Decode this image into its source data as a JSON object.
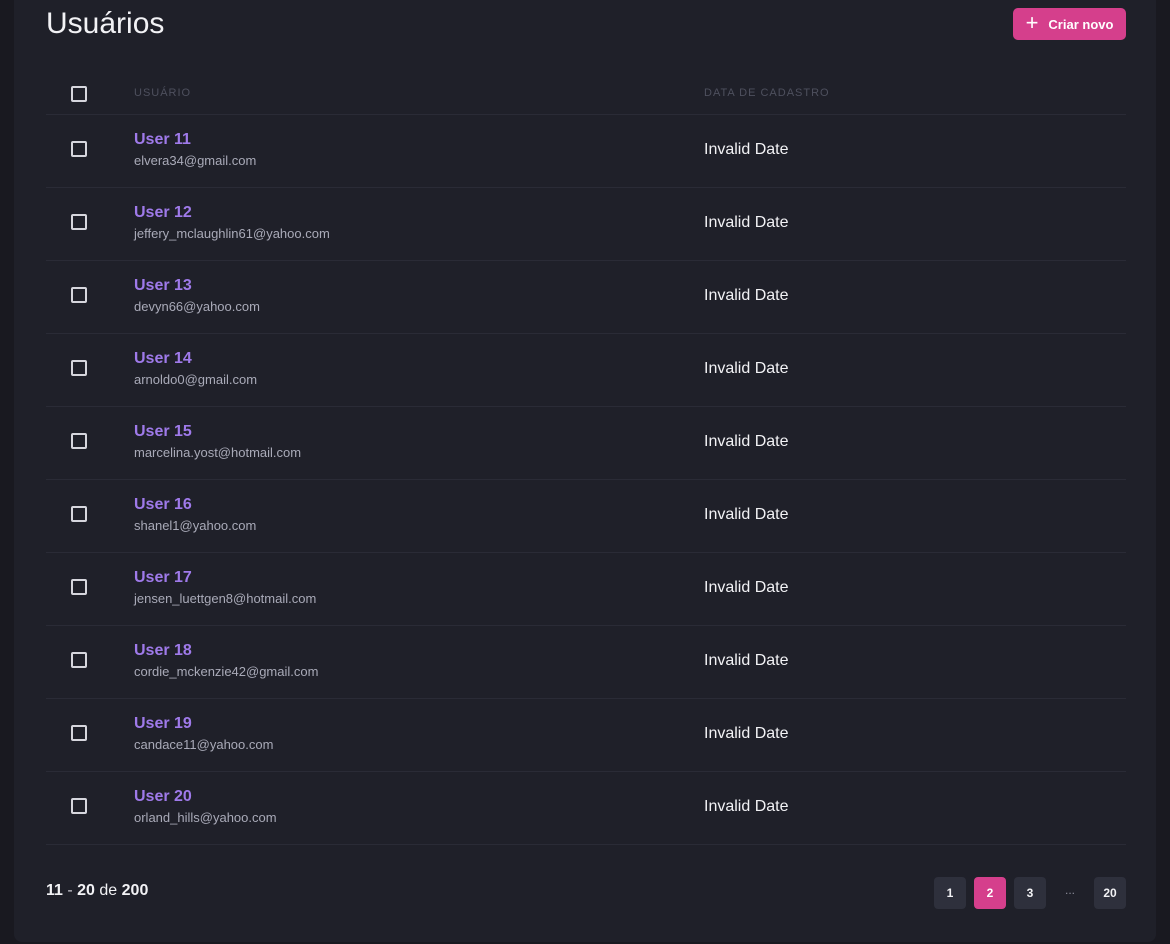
{
  "header": {
    "title": "Usuários",
    "create_label": "Criar novo",
    "create_icon": "plus-icon"
  },
  "table": {
    "columns": {
      "user": "Usuário",
      "registered": "Data de cadastro"
    },
    "rows": [
      {
        "name": "User 11",
        "email": "elvera34@gmail.com",
        "date": "Invalid Date"
      },
      {
        "name": "User 12",
        "email": "jeffery_mclaughlin61@yahoo.com",
        "date": "Invalid Date"
      },
      {
        "name": "User 13",
        "email": "devyn66@yahoo.com",
        "date": "Invalid Date"
      },
      {
        "name": "User 14",
        "email": "arnoldo0@gmail.com",
        "date": "Invalid Date"
      },
      {
        "name": "User 15",
        "email": "marcelina.yost@hotmail.com",
        "date": "Invalid Date"
      },
      {
        "name": "User 16",
        "email": "shanel1@yahoo.com",
        "date": "Invalid Date"
      },
      {
        "name": "User 17",
        "email": "jensen_luettgen8@hotmail.com",
        "date": "Invalid Date"
      },
      {
        "name": "User 18",
        "email": "cordie_mckenzie42@gmail.com",
        "date": "Invalid Date"
      },
      {
        "name": "User 19",
        "email": "candace11@yahoo.com",
        "date": "Invalid Date"
      },
      {
        "name": "User 20",
        "email": "orland_hills@yahoo.com",
        "date": "Invalid Date"
      }
    ]
  },
  "footer": {
    "range_start": "11",
    "range_sep": "-",
    "range_end": "20",
    "range_of": "de",
    "total": "200",
    "pages": [
      "1",
      "2",
      "3",
      "...",
      "20"
    ],
    "current_page": "2"
  },
  "colors": {
    "accent": "#d53f8c",
    "user_link": "#9f7aea",
    "background": "#191920",
    "panel": "#1f2029"
  }
}
